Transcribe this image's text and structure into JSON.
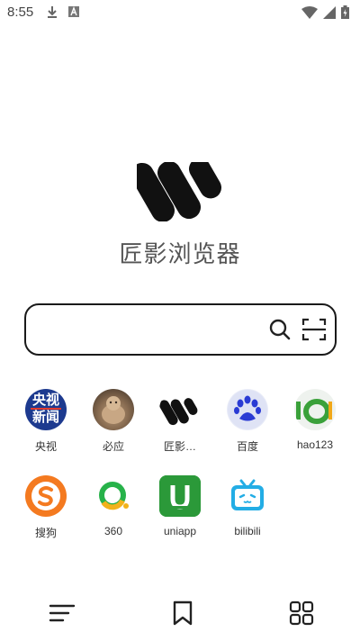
{
  "status_bar": {
    "time": "8:55",
    "icons": [
      "download-icon",
      "a-icon",
      "wifi-icon",
      "signal-icon",
      "battery-icon"
    ]
  },
  "app": {
    "title": "匠影浏览器",
    "logo": "w-logo"
  },
  "search": {
    "value": "",
    "placeholder": "",
    "search_icon": "search-icon",
    "scan_icon": "scan-icon"
  },
  "shortcuts": [
    {
      "label": "央视",
      "icon": "cctv-news-icon",
      "badge_text": [
        "央视",
        "新闻"
      ]
    },
    {
      "label": "必应",
      "icon": "bing-icon"
    },
    {
      "label": "匠影…",
      "icon": "w-logo-icon"
    },
    {
      "label": "百度",
      "icon": "baidu-paw-icon"
    },
    {
      "label": "hao123",
      "icon": "hao123-icon"
    },
    {
      "label": "搜狗",
      "icon": "sogou-icon"
    },
    {
      "label": "360",
      "icon": "360-icon"
    },
    {
      "label": "uniapp",
      "icon": "uniapp-icon"
    },
    {
      "label": "bilibili",
      "icon": "bilibili-icon"
    }
  ],
  "bottom_bar": {
    "menu": "menu-icon",
    "bookmark": "bookmark-icon",
    "tabs": "grid-icon"
  },
  "colors": {
    "accent": "#1a1a1a",
    "cctv_blue": "#1d3a8f",
    "sogou_orange": "#f47a20",
    "360_green": "#27b24a",
    "uniapp_green": "#2b9939",
    "bilibili_blue": "#23ade5",
    "baidu_blue": "#2a3bd4"
  }
}
